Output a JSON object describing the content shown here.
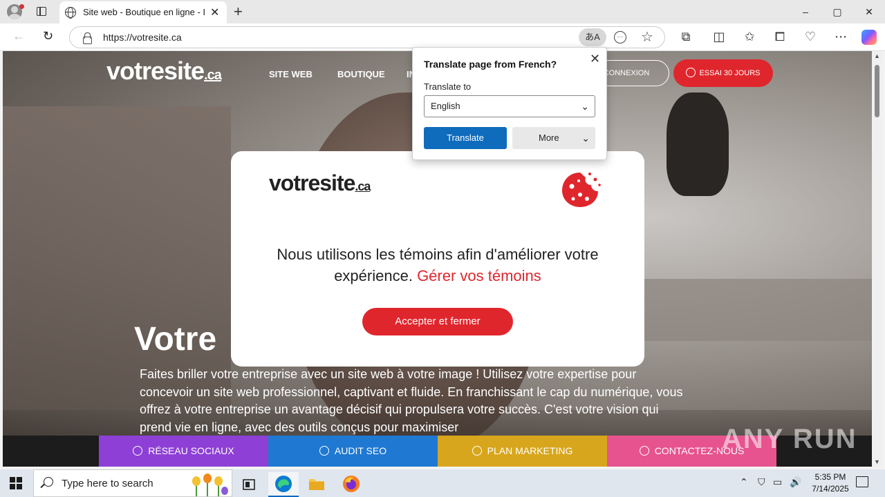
{
  "browser": {
    "tab_title": "Site web - Boutique en ligne - Info",
    "url": "https://votresite.ca",
    "translate_icon_label": "あA",
    "window_controls": [
      "–",
      "▢",
      "✕"
    ]
  },
  "site": {
    "logo_main": "votresite",
    "logo_ca": ".ca",
    "nav": [
      "SITE WEB",
      "BOUTIQUE",
      "IN"
    ],
    "connexion": "CONNEXION",
    "essai": "ESSAI 30 JOURS",
    "hero_title": "Votre",
    "hero_text": "Faites briller votre entreprise avec un site web à votre image ! Utilisez votre expertise pour concevoir un site web professionnel, captivant et fluide. En franchissant le cap du numérique, vous offrez à votre entreprise un avantage décisif qui propulsera votre succès. C'est votre vision qui prend vie en ligne, avec des outils conçus pour maximiser",
    "bottom_bar": [
      {
        "label": "RÉSEAU SOCIAUX",
        "color": "#8e3fd6"
      },
      {
        "label": "AUDIT SEO",
        "color": "#1f78d1"
      },
      {
        "label": "PLAN MARKETING",
        "color": "#d8a61c"
      },
      {
        "label": "CONTACTEZ-NOUS",
        "color": "#e7538f"
      }
    ],
    "watermark": "ANY RUN"
  },
  "cookie_modal": {
    "logo_main": "votresite",
    "logo_ca": ".ca",
    "text": "Nous utilisons les témoins afin d'améliorer votre expérience.",
    "link": "Gérer vos témoins",
    "accept": "Accepter et fermer"
  },
  "translate_popup": {
    "title": "Translate page from French?",
    "label": "Translate to",
    "selected_language": "English",
    "translate_button": "Translate",
    "more_button": "More"
  },
  "taskbar": {
    "search_placeholder": "Type here to search",
    "time": "5:35 PM",
    "date": "7/14/2025"
  },
  "colors": {
    "brand_red": "#e0262d",
    "translate_blue": "#0f6cbd"
  }
}
